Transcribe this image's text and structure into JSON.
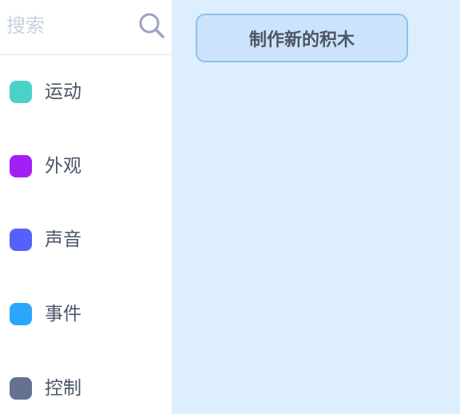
{
  "search": {
    "placeholder": "搜索",
    "value": ""
  },
  "categories": [
    {
      "label": "运动",
      "color": "#4cd1c7"
    },
    {
      "label": "外观",
      "color": "#a320f5"
    },
    {
      "label": "声音",
      "color": "#5461fa"
    },
    {
      "label": "事件",
      "color": "#2aa6fc"
    },
    {
      "label": "控制",
      "color": "#647290"
    }
  ],
  "workspace": {
    "make_block_label": "制作新的积木"
  },
  "colors": {
    "workspace_bg": "#ddeeff",
    "button_bg": "#cbe4fb",
    "button_border": "#8cc2ee",
    "search_icon": "#9aa3c0"
  }
}
